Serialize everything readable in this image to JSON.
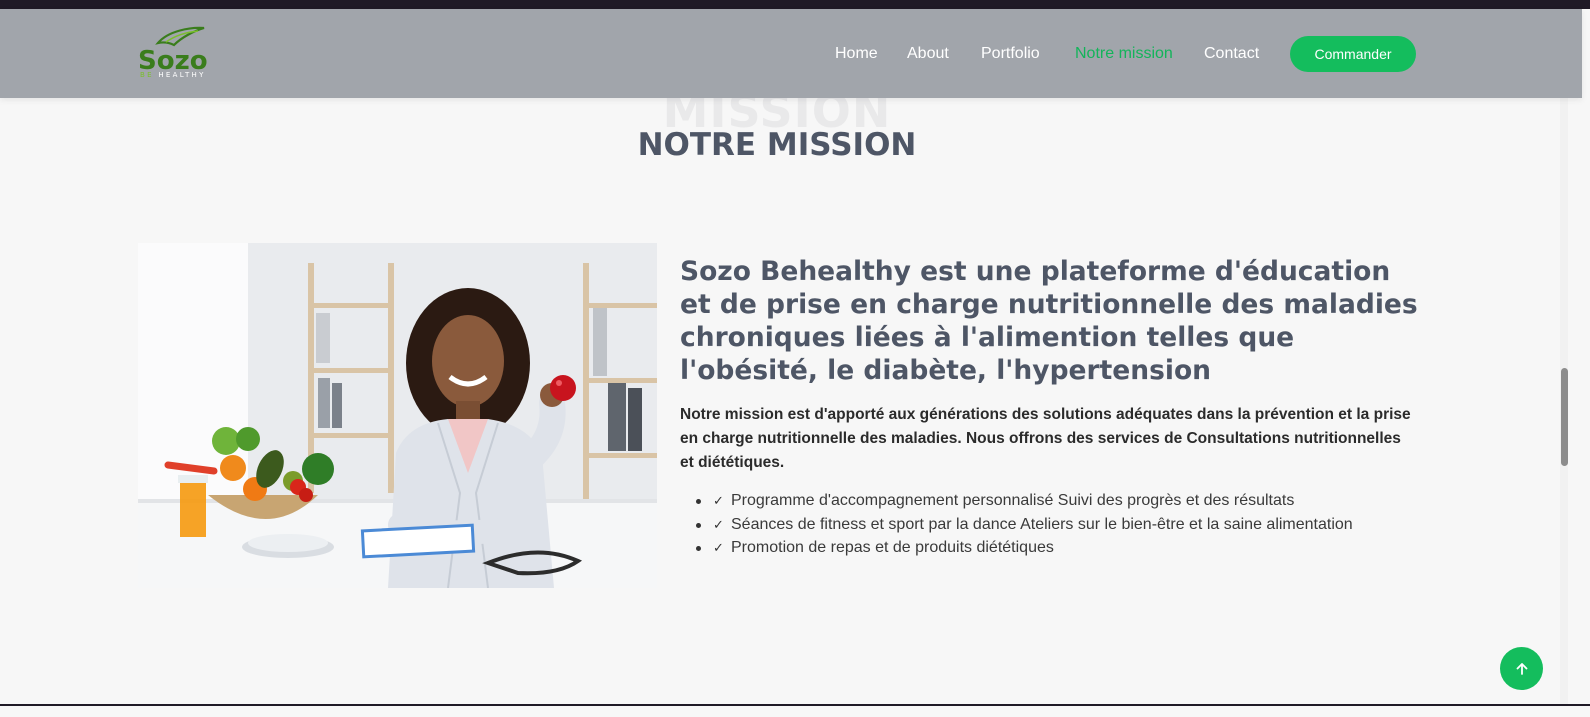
{
  "brand": {
    "logo_text": "Sozo",
    "logo_sub_prefix": "BE",
    "logo_sub_suffix": "HEALTHY",
    "colors": {
      "green": "#14bd5d",
      "dark_green": "#3a7d1c",
      "header_bg": "#a1a5ab",
      "title": "#4e5666"
    }
  },
  "nav": {
    "items": [
      {
        "label": "Home",
        "active": false
      },
      {
        "label": "About",
        "active": false
      },
      {
        "label": "Portfolio",
        "active": false
      },
      {
        "label": "Notre mission",
        "active": true
      },
      {
        "label": "Contact",
        "active": false
      }
    ],
    "cta_label": "Commander"
  },
  "section": {
    "bg_title": "MISSION",
    "title": "NOTRE MISSION"
  },
  "content": {
    "image_alt": "Nutritionniste souriante tenant une pomme devant un bol de fruits et légumes",
    "headline": "Sozo Behealthy est une plateforme d'éducation et de prise en charge nutritionnelle des maladies chroniques liées à l'alimention telles que l'obésité, le diabète, l'hypertension",
    "lead": "Notre mission est d'apporté aux générations des solutions adéquates dans la prévention et la prise en charge nutritionnelle des maladies. Nous offrons des services de Consultations nutritionnelles et diététiques.",
    "features": [
      "Programme d'accompagnement personnalisé Suivi des progrès et des résultats",
      "Séances de fitness et sport par la dance Ateliers sur le bien-être et la saine alimentation",
      "Promotion de repas et de produits diététiques"
    ]
  },
  "icons": {
    "check": "check-icon",
    "back_to_top": "arrow-up-icon",
    "logo_leaf": "leaf-icon"
  }
}
